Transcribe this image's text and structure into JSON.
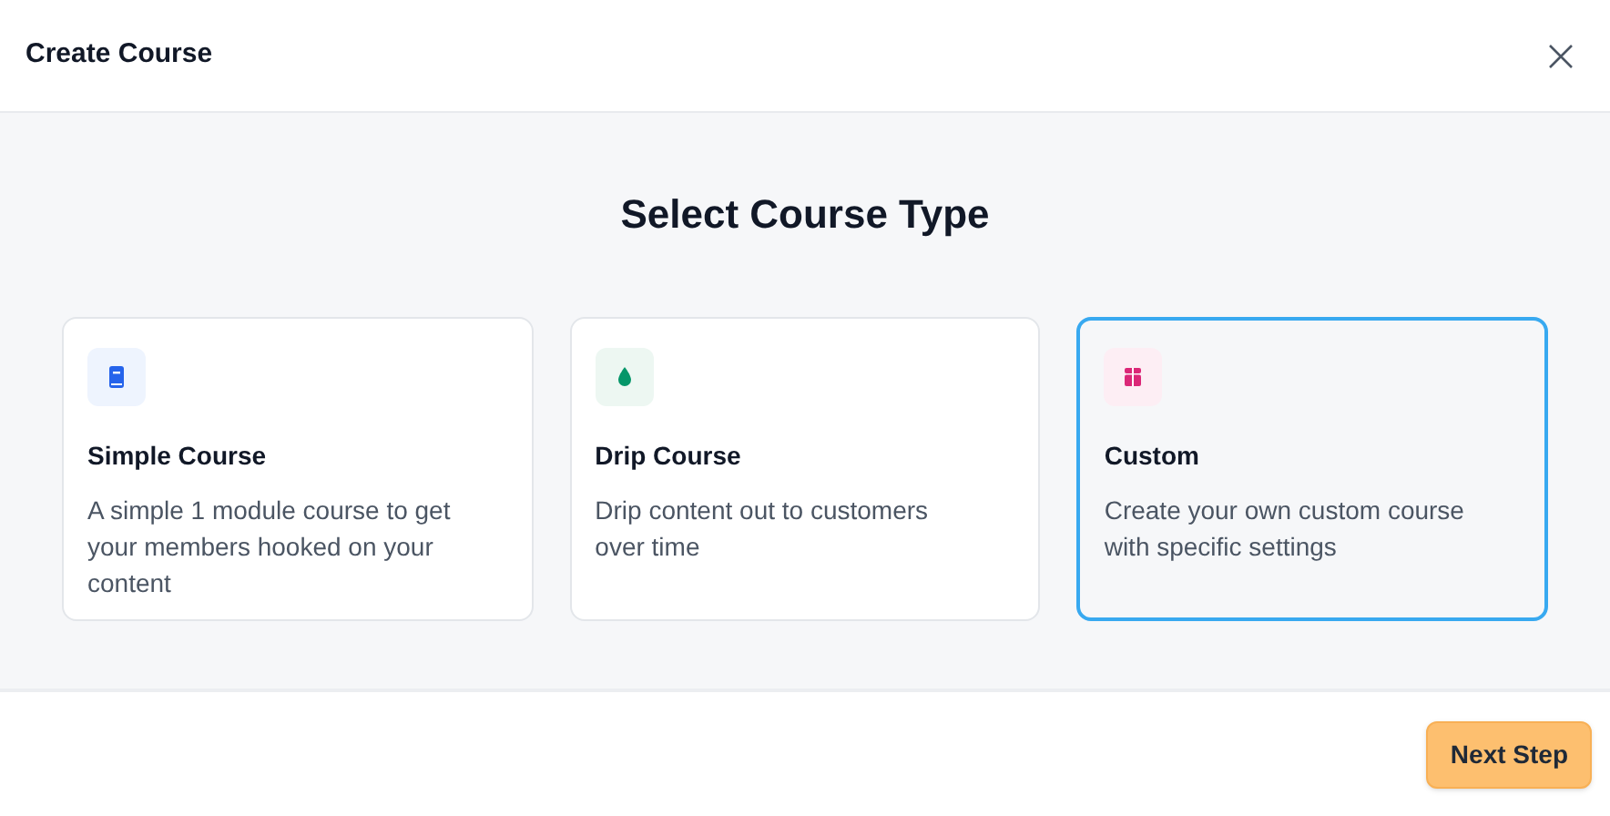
{
  "dialog": {
    "title": "Create Course"
  },
  "heading": "Select Course Type",
  "options": [
    {
      "kind": "book",
      "color": "#2563eb",
      "title": "Simple Course",
      "description": "A simple 1 module course to get your members hooked on your content",
      "selected": false
    },
    {
      "kind": "drop",
      "color": "#059669",
      "title": "Drip Course",
      "description": "Drip content out to customers over time",
      "selected": false
    },
    {
      "kind": "box",
      "color": "#db2777",
      "title": "Custom",
      "description": "Create your own custom course with specific settings",
      "selected": true
    }
  ],
  "footer": {
    "next_button": "Next Step"
  }
}
